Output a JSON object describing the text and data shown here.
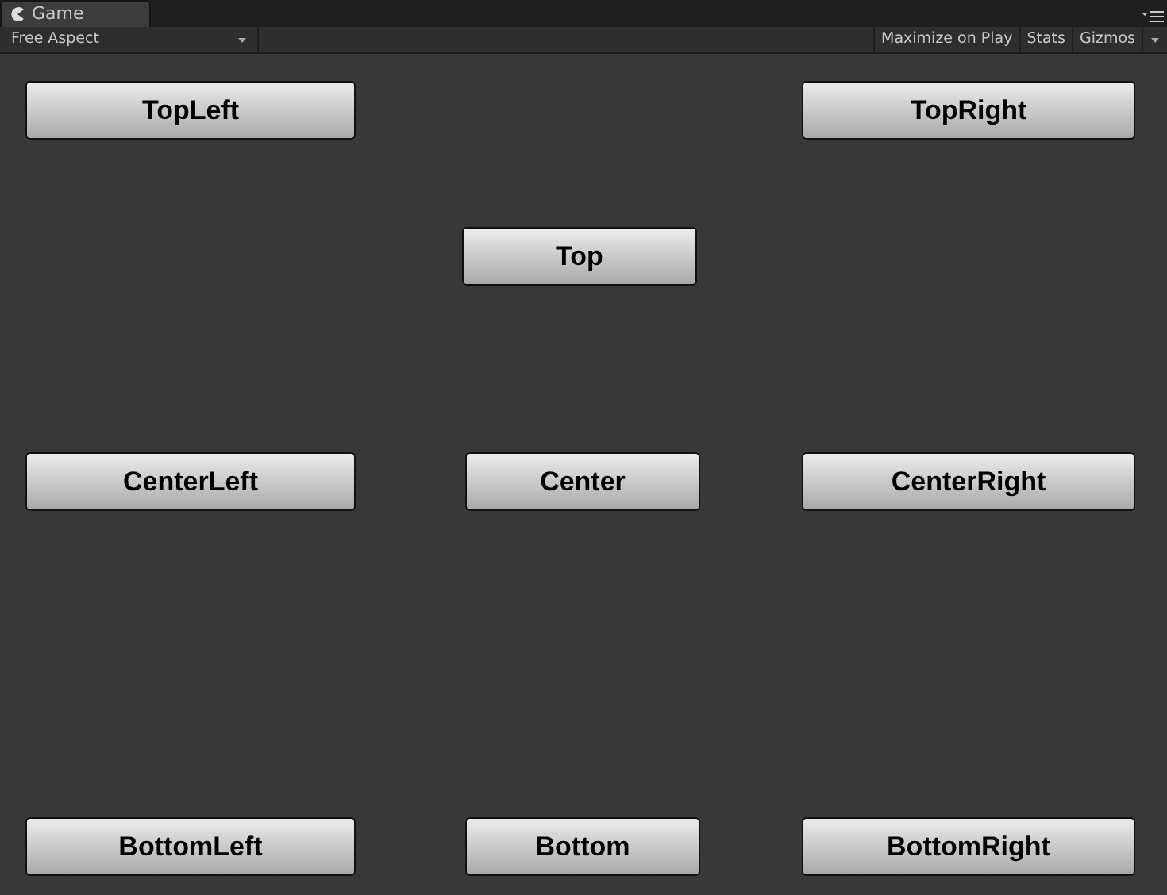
{
  "tabs": [
    {
      "label": "Game",
      "selected": true
    }
  ],
  "toolbar": {
    "aspect": "Free Aspect",
    "toggles": [
      {
        "label": "Maximize on Play",
        "on": false
      },
      {
        "label": "Stats",
        "on": false
      },
      {
        "label": "Gizmos",
        "on": false
      }
    ]
  },
  "buttons": [
    {
      "label": "TopLeft",
      "kind": "topleft"
    },
    {
      "label": "TopRight",
      "kind": "topright"
    },
    {
      "label": "Top",
      "kind": "top"
    },
    {
      "label": "CenterLeft",
      "kind": "centerleft"
    },
    {
      "label": "Center",
      "kind": "center"
    },
    {
      "label": "CenterRight",
      "kind": "centerright"
    },
    {
      "label": "BottomLeft",
      "kind": "bottomleft"
    },
    {
      "label": "Bottom",
      "kind": "bottom"
    },
    {
      "label": "BottomRight",
      "kind": "bottomright"
    }
  ]
}
